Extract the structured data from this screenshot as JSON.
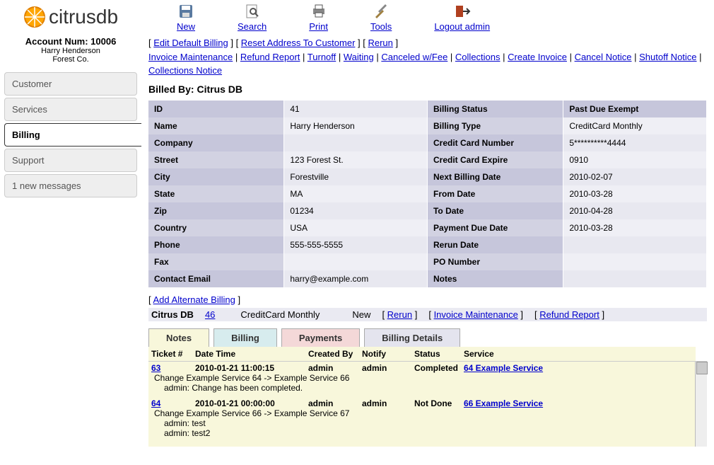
{
  "logo_text": "citrusdb",
  "account": {
    "num_label": "Account Num:  10006",
    "name": "Harry Henderson",
    "company": "Forest Co."
  },
  "nav": {
    "customer": "Customer",
    "services": "Services",
    "billing": "Billing",
    "support": "Support",
    "messages": "1 new messages"
  },
  "toolbar": {
    "new": "New",
    "search": "Search",
    "print": "Print",
    "tools": "Tools",
    "logout": "Logout admin"
  },
  "links": {
    "edit_default_billing": "Edit Default Billing",
    "reset_address": "Reset Address To Customer",
    "rerun": "Rerun",
    "invoice_maintenance": "Invoice Maintenance",
    "refund_report": "Refund Report",
    "turnoff": "Turnoff",
    "waiting": "Waiting",
    "canceled_wfee": "Canceled w/Fee",
    "collections": "Collections",
    "create_invoice": "Create Invoice",
    "cancel_notice": "Cancel Notice",
    "shutoff_notice": "Shutoff Notice",
    "collections_notice": "Collections Notice"
  },
  "billed_by": "Billed By: Citrus DB",
  "details": {
    "id_label": "ID",
    "id_val": "41",
    "name_label": "Name",
    "name_val": "Harry Henderson",
    "company_label": "Company",
    "company_val": "",
    "street_label": "Street",
    "street_val": "123 Forest St.",
    "city_label": "City",
    "city_val": "Forestville",
    "state_label": "State",
    "state_val": "MA",
    "zip_label": "Zip",
    "zip_val": "01234",
    "country_label": "Country",
    "country_val": "USA",
    "phone_label": "Phone",
    "phone_val": "555-555-5555",
    "fax_label": "Fax",
    "fax_val": "",
    "email_label": "Contact Email",
    "email_val": "harry@example.com",
    "billing_status_label": "Billing Status",
    "billing_status_val": "",
    "billing_type_label": "Billing Type",
    "billing_type_val": "CreditCard Monthly",
    "cc_num_label": "Credit Card Number",
    "cc_num_val": "5**********4444",
    "cc_exp_label": "Credit Card Expire",
    "cc_exp_val": "0910",
    "next_billing_label": "Next Billing Date",
    "next_billing_val": "2010-02-07",
    "from_date_label": "From Date",
    "from_date_val": "2010-03-28",
    "to_date_label": "To Date",
    "to_date_val": "2010-04-28",
    "payment_due_label": "Payment Due Date",
    "payment_due_val": "2010-03-28",
    "rerun_date_label": "Rerun Date",
    "rerun_date_val": "",
    "po_label": "PO Number",
    "po_val": "",
    "notes_label": "Notes",
    "notes_val": "",
    "past_due_label": "Past Due Exempt",
    "past_due_val": ""
  },
  "alt_billing": {
    "add_link": "Add Alternate Billing",
    "org": "Citrus DB",
    "id": "46",
    "type": "CreditCard Monthly",
    "status": "New",
    "rerun": "Rerun",
    "invoice_maint": "Invoice Maintenance",
    "refund_report": "Refund Report"
  },
  "tabs": {
    "notes": "Notes",
    "billing": "Billing",
    "payments": "Payments",
    "billing_details": "Billing Details"
  },
  "ticket_headers": {
    "ticket": "Ticket #",
    "datetime": "Date Time",
    "created_by": "Created By",
    "notify": "Notify",
    "status": "Status",
    "service": "Service"
  },
  "tickets": [
    {
      "id": "63",
      "datetime": "2010-01-21 11:00:15",
      "created_by": "admin",
      "notify": "admin",
      "status": "Completed",
      "service": "64 Example Service",
      "body": "Change Example Service 64 -> Example Service 66",
      "sub": [
        "admin: Change has been completed."
      ]
    },
    {
      "id": "64",
      "datetime": "2010-01-21 00:00:00",
      "created_by": "admin",
      "notify": "admin",
      "status": "Not Done",
      "service": "66 Example Service",
      "body": "Change Example Service 66 -> Example Service 67",
      "sub": [
        "admin: test",
        "admin: test2"
      ]
    }
  ]
}
